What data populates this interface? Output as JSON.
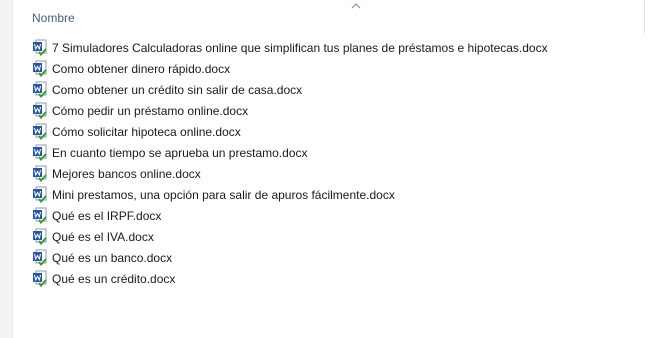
{
  "header": {
    "name_column": "Nombre"
  },
  "icons": {
    "file": "word-document-icon",
    "sort": "sort-ascending-icon"
  },
  "colors": {
    "header_text": "#4c607a",
    "word_blue": "#2b5797",
    "check_green": "#3a9a3a"
  },
  "files": [
    {
      "name": "7 Simuladores Calculadoras online que simplifican tus planes de préstamos e hipotecas.docx"
    },
    {
      "name": "Como obtener dinero rápido.docx"
    },
    {
      "name": "Como obtener un crédito sin salir de casa.docx"
    },
    {
      "name": "Cómo pedir un préstamo online.docx"
    },
    {
      "name": "Cómo solicitar hipoteca online.docx"
    },
    {
      "name": "En cuanto tiempo se aprueba un prestamo.docx"
    },
    {
      "name": "Mejores bancos online.docx"
    },
    {
      "name": "Mini prestamos, una opción para salir de apuros fácilmente.docx"
    },
    {
      "name": "Qué es el IRPF.docx"
    },
    {
      "name": "Qué es el IVA.docx"
    },
    {
      "name": "Qué es un banco.docx"
    },
    {
      "name": "Qué es un crédito.docx"
    }
  ]
}
